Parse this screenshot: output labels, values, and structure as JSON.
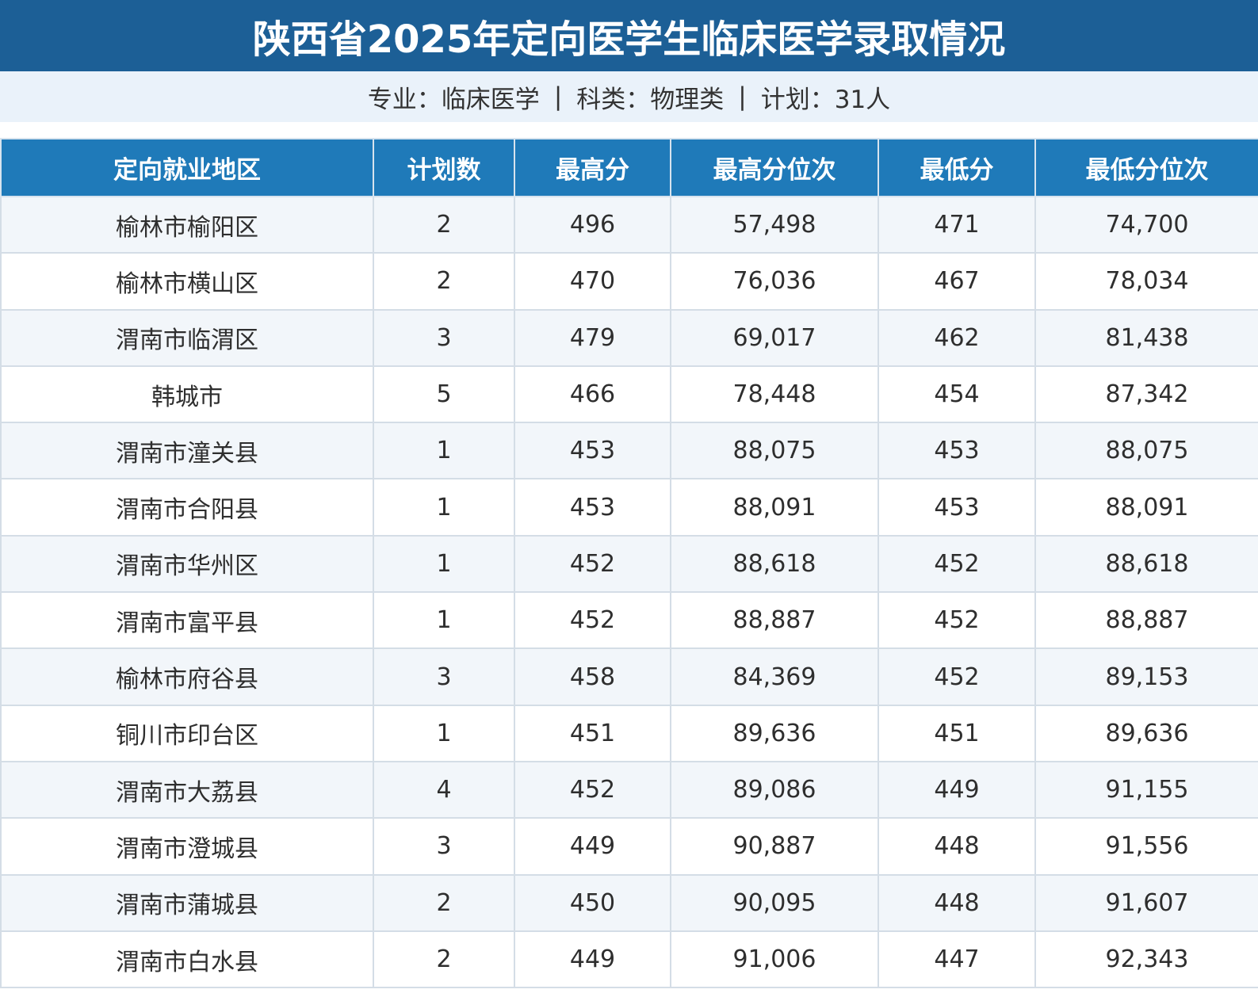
{
  "title": "陕西省2025年定向医学生临床医学录取情况",
  "subtitle": {
    "major": "专业：临床医学",
    "category": "科类：物理类",
    "plan": "计划：31人",
    "separator": "|"
  },
  "table": {
    "headers": [
      "定向就业地区",
      "计划数",
      "最高分",
      "最高分位次",
      "最低分",
      "最低分位次"
    ],
    "rows": [
      [
        "榆林市榆阳区",
        "2",
        "496",
        "57,498",
        "471",
        "74,700"
      ],
      [
        "榆林市横山区",
        "2",
        "470",
        "76,036",
        "467",
        "78,034"
      ],
      [
        "渭南市临渭区",
        "3",
        "479",
        "69,017",
        "462",
        "81,438"
      ],
      [
        "韩城市",
        "5",
        "466",
        "78,448",
        "454",
        "87,342"
      ],
      [
        "渭南市潼关县",
        "1",
        "453",
        "88,075",
        "453",
        "88,075"
      ],
      [
        "渭南市合阳县",
        "1",
        "453",
        "88,091",
        "453",
        "88,091"
      ],
      [
        "渭南市华州区",
        "1",
        "452",
        "88,618",
        "452",
        "88,618"
      ],
      [
        "渭南市富平县",
        "1",
        "452",
        "88,887",
        "452",
        "88,887"
      ],
      [
        "榆林市府谷县",
        "3",
        "458",
        "84,369",
        "452",
        "89,153"
      ],
      [
        "铜川市印台区",
        "1",
        "451",
        "89,636",
        "451",
        "89,636"
      ],
      [
        "渭南市大荔县",
        "4",
        "452",
        "89,086",
        "449",
        "91,155"
      ],
      [
        "渭南市澄城县",
        "3",
        "449",
        "90,887",
        "448",
        "91,556"
      ],
      [
        "渭南市蒲城县",
        "2",
        "450",
        "90,095",
        "448",
        "91,607"
      ],
      [
        "渭南市白水县",
        "2",
        "449",
        "91,006",
        "447",
        "92,343"
      ]
    ]
  },
  "colors": {
    "title_bg": "#1c5f96",
    "header_bg": "#1f7ab9",
    "subtitle_bg": "#eaf2fa",
    "row_alt_bg": "#f2f6fa"
  }
}
